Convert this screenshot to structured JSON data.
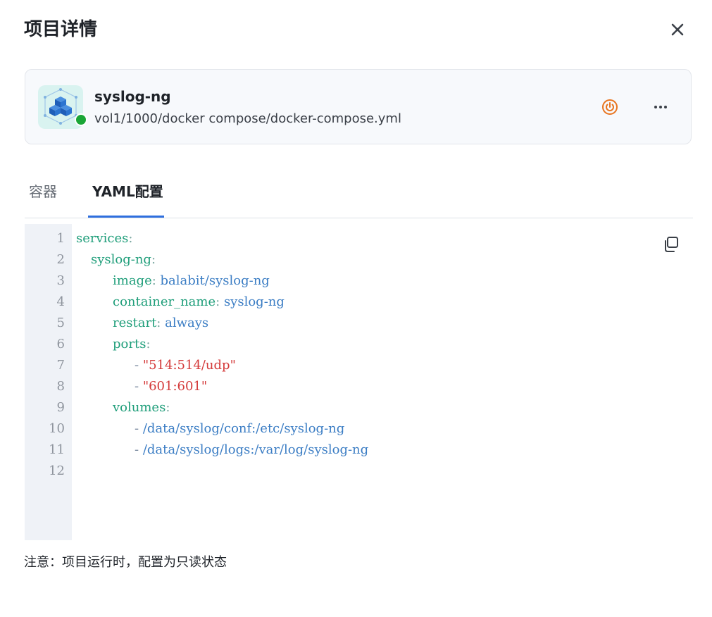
{
  "dialog": {
    "title": "项目详情",
    "close_icon": "close-icon"
  },
  "project": {
    "name": "syslog-ng",
    "path": "vol1/1000/docker compose/docker-compose.yml",
    "status_color": "#1aa636",
    "logo_icon": "docker-cubes-logo",
    "power_icon": "power-icon",
    "power_color": "#e8741e",
    "more_icon": "more-horizontal-icon"
  },
  "tabs": [
    {
      "label": "容器",
      "active": false
    },
    {
      "label": "YAML配置",
      "active": true
    }
  ],
  "accent_color": "#2f6fde",
  "editor": {
    "copy_icon": "copy-icon",
    "line_numbers": [
      "1",
      "2",
      "3",
      "4",
      "5",
      "6",
      "7",
      "8",
      "9",
      "10",
      "11",
      "12"
    ],
    "lines": [
      {
        "key": "services",
        "colon": ":",
        "value": "",
        "dash": "",
        "string": ""
      },
      {
        "key": "syslog-ng",
        "colon": ":",
        "value": "",
        "dash": "",
        "string": ""
      },
      {
        "key": "image",
        "colon": ":",
        "value": " balabit/syslog-ng",
        "dash": "",
        "string": ""
      },
      {
        "key": "container_name",
        "colon": ":",
        "value": " syslog-ng",
        "dash": "",
        "string": ""
      },
      {
        "key": "restart",
        "colon": ":",
        "value": " always",
        "dash": "",
        "string": ""
      },
      {
        "key": "ports",
        "colon": ":",
        "value": "",
        "dash": "",
        "string": ""
      },
      {
        "key": "",
        "colon": "",
        "value": "",
        "dash": "- ",
        "string": "\"514:514/udp\""
      },
      {
        "key": "",
        "colon": "",
        "value": "",
        "dash": "- ",
        "string": "\"601:601\""
      },
      {
        "key": "volumes",
        "colon": ":",
        "value": "",
        "dash": "",
        "string": ""
      },
      {
        "key": "",
        "colon": "",
        "value": "/data/syslog/conf:/etc/syslog-ng",
        "dash": "- ",
        "string": ""
      },
      {
        "key": "",
        "colon": "",
        "value": "/data/syslog/logs:/var/log/syslog-ng",
        "dash": "- ",
        "string": ""
      },
      {
        "key": "",
        "colon": "",
        "value": "",
        "dash": "",
        "string": ""
      }
    ]
  },
  "note": "注意：项目运行时，配置为只读状态"
}
